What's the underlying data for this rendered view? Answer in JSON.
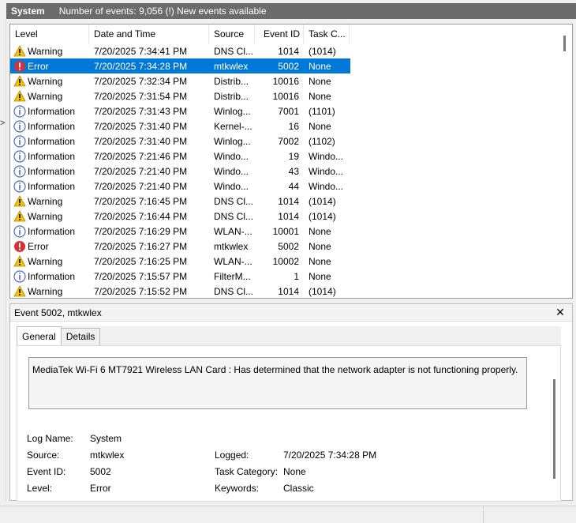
{
  "titlebar": {
    "log_name": "System",
    "summary": "Number of events: 9,056 (!) New events available"
  },
  "columns": {
    "level": "Level",
    "date": "Date and Time",
    "source": "Source",
    "event_id": "Event ID",
    "task": "Task C..."
  },
  "events": [
    {
      "level": "Warning",
      "icon": "warning-icon",
      "date": "7/20/2025 7:34:41 PM",
      "source": "DNS Cl...",
      "id": "1014",
      "task": "(1014)"
    },
    {
      "level": "Error",
      "icon": "error-icon",
      "date": "7/20/2025 7:34:28 PM",
      "source": "mtkwlex",
      "id": "5002",
      "task": "None",
      "selected": true
    },
    {
      "level": "Warning",
      "icon": "warning-icon",
      "date": "7/20/2025 7:32:34 PM",
      "source": "Distrib...",
      "id": "10016",
      "task": "None"
    },
    {
      "level": "Warning",
      "icon": "warning-icon",
      "date": "7/20/2025 7:31:54 PM",
      "source": "Distrib...",
      "id": "10016",
      "task": "None"
    },
    {
      "level": "Information",
      "icon": "information-icon",
      "date": "7/20/2025 7:31:43 PM",
      "source": "Winlog...",
      "id": "7001",
      "task": "(1101)"
    },
    {
      "level": "Information",
      "icon": "information-icon",
      "date": "7/20/2025 7:31:40 PM",
      "source": "Kernel-...",
      "id": "16",
      "task": "None"
    },
    {
      "level": "Information",
      "icon": "information-icon",
      "date": "7/20/2025 7:31:40 PM",
      "source": "Winlog...",
      "id": "7002",
      "task": "(1102)"
    },
    {
      "level": "Information",
      "icon": "information-icon",
      "date": "7/20/2025 7:21:46 PM",
      "source": "Windo...",
      "id": "19",
      "task": "Windo..."
    },
    {
      "level": "Information",
      "icon": "information-icon",
      "date": "7/20/2025 7:21:40 PM",
      "source": "Windo...",
      "id": "43",
      "task": "Windo..."
    },
    {
      "level": "Information",
      "icon": "information-icon",
      "date": "7/20/2025 7:21:40 PM",
      "source": "Windo...",
      "id": "44",
      "task": "Windo..."
    },
    {
      "level": "Warning",
      "icon": "warning-icon",
      "date": "7/20/2025 7:16:45 PM",
      "source": "DNS Cl...",
      "id": "1014",
      "task": "(1014)"
    },
    {
      "level": "Warning",
      "icon": "warning-icon",
      "date": "7/20/2025 7:16:44 PM",
      "source": "DNS Cl...",
      "id": "1014",
      "task": "(1014)"
    },
    {
      "level": "Information",
      "icon": "information-icon",
      "date": "7/20/2025 7:16:29 PM",
      "source": "WLAN-...",
      "id": "10001",
      "task": "None"
    },
    {
      "level": "Error",
      "icon": "error-icon",
      "date": "7/20/2025 7:16:27 PM",
      "source": "mtkwlex",
      "id": "5002",
      "task": "None"
    },
    {
      "level": "Warning",
      "icon": "warning-icon",
      "date": "7/20/2025 7:16:25 PM",
      "source": "WLAN-...",
      "id": "10002",
      "task": "None"
    },
    {
      "level": "Information",
      "icon": "information-icon",
      "date": "7/20/2025 7:15:57 PM",
      "source": "FilterM...",
      "id": "1",
      "task": "None"
    },
    {
      "level": "Warning",
      "icon": "warning-icon",
      "date": "7/20/2025 7:15:52 PM",
      "source": "DNS Cl...",
      "id": "1014",
      "task": "(1014)"
    }
  ],
  "detail": {
    "header": "Event 5002, mtkwlex",
    "close_icon": "close-icon",
    "tabs": [
      "General",
      "Details"
    ],
    "description": "MediaTek Wi-Fi 6 MT7921 Wireless LAN Card : Has determined that the network adapter is not functioning properly.",
    "props": {
      "log_name_label": "Log Name:",
      "log_name_value": "System",
      "source_label": "Source:",
      "source_value": "mtkwlex",
      "logged_label": "Logged:",
      "logged_value": "7/20/2025 7:34:28 PM",
      "event_id_label": "Event ID:",
      "event_id_value": "5002",
      "task_category_label": "Task Category:",
      "task_category_value": "None",
      "level_label": "Level:",
      "level_value": "Error",
      "keywords_label": "Keywords:",
      "keywords_value": "Classic"
    }
  },
  "colors": {
    "selection": "#0078d7",
    "titlebar": "#6b6b6b",
    "warning": "#f5c400",
    "error": "#d13438",
    "information": "#4a6fb3"
  }
}
